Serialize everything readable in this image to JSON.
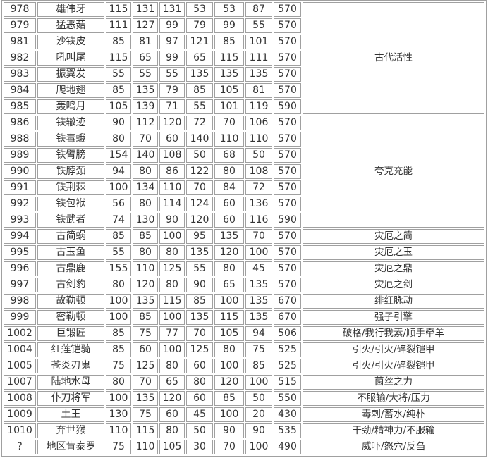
{
  "rows": [
    {
      "no": "978",
      "name": "雄伟牙",
      "stats": [
        "115",
        "131",
        "131",
        "53",
        "53",
        "87"
      ],
      "total": "570",
      "ability": "古代活性",
      "span": 7
    },
    {
      "no": "979",
      "name": "猛恶菇",
      "stats": [
        "111",
        "127",
        "99",
        "79",
        "99",
        "55"
      ],
      "total": "570"
    },
    {
      "no": "981",
      "name": "沙铁皮",
      "stats": [
        "85",
        "81",
        "97",
        "121",
        "85",
        "101"
      ],
      "total": "570"
    },
    {
      "no": "982",
      "name": "吼叫尾",
      "stats": [
        "115",
        "65",
        "99",
        "65",
        "115",
        "111"
      ],
      "total": "570"
    },
    {
      "no": "983",
      "name": "振翼发",
      "stats": [
        "55",
        "55",
        "55",
        "135",
        "135",
        "135"
      ],
      "total": "570"
    },
    {
      "no": "984",
      "name": "爬地翅",
      "stats": [
        "85",
        "135",
        "79",
        "85",
        "105",
        "81"
      ],
      "total": "570"
    },
    {
      "no": "985",
      "name": "轰鸣月",
      "stats": [
        "105",
        "139",
        "71",
        "55",
        "101",
        "119"
      ],
      "total": "590"
    },
    {
      "no": "986",
      "name": "铁辙迹",
      "stats": [
        "90",
        "112",
        "120",
        "72",
        "70",
        "106"
      ],
      "total": "570",
      "ability": "夸克充能",
      "span": 7
    },
    {
      "no": "988",
      "name": "铁毒蛾",
      "stats": [
        "80",
        "70",
        "60",
        "140",
        "110",
        "110"
      ],
      "total": "570"
    },
    {
      "no": "989",
      "name": "铁臂膀",
      "stats": [
        "154",
        "140",
        "108",
        "50",
        "68",
        "50"
      ],
      "total": "570"
    },
    {
      "no": "990",
      "name": "铁脖颈",
      "stats": [
        "94",
        "80",
        "86",
        "122",
        "80",
        "108"
      ],
      "total": "570"
    },
    {
      "no": "991",
      "name": "铁荆棘",
      "stats": [
        "100",
        "134",
        "110",
        "70",
        "84",
        "72"
      ],
      "total": "570"
    },
    {
      "no": "992",
      "name": "铁包袱",
      "stats": [
        "56",
        "80",
        "114",
        "124",
        "60",
        "136"
      ],
      "total": "570"
    },
    {
      "no": "993",
      "name": "铁武者",
      "stats": [
        "74",
        "130",
        "90",
        "120",
        "60",
        "116"
      ],
      "total": "590"
    },
    {
      "no": "994",
      "name": "古简蜗",
      "stats": [
        "85",
        "85",
        "100",
        "95",
        "135",
        "70"
      ],
      "total": "570",
      "ability": "灾厄之简",
      "span": 1
    },
    {
      "no": "995",
      "name": "古玉鱼",
      "stats": [
        "55",
        "80",
        "80",
        "135",
        "120",
        "100"
      ],
      "total": "570",
      "ability": "灾厄之玉",
      "span": 1
    },
    {
      "no": "996",
      "name": "古鼎鹿",
      "stats": [
        "155",
        "110",
        "125",
        "55",
        "80",
        "45"
      ],
      "total": "570",
      "ability": "灾厄之鼎",
      "span": 1
    },
    {
      "no": "997",
      "name": "古剑豹",
      "stats": [
        "80",
        "120",
        "80",
        "90",
        "65",
        "135"
      ],
      "total": "570",
      "ability": "灾厄之剑",
      "span": 1
    },
    {
      "no": "998",
      "name": "故勒顿",
      "stats": [
        "100",
        "135",
        "115",
        "85",
        "100",
        "135"
      ],
      "total": "670",
      "ability": "绯红脉动",
      "span": 1
    },
    {
      "no": "999",
      "name": "密勒顿",
      "stats": [
        "100",
        "85",
        "100",
        "135",
        "115",
        "135"
      ],
      "total": "670",
      "ability": "强子引擎",
      "span": 1
    },
    {
      "no": "1002",
      "name": "巨锻匠",
      "stats": [
        "85",
        "75",
        "77",
        "70",
        "105",
        "94"
      ],
      "total": "506",
      "ability": "破格/我行我素/顺手牵羊",
      "span": 1
    },
    {
      "no": "1004",
      "name": "红莲铠骑",
      "stats": [
        "85",
        "60",
        "100",
        "125",
        "80",
        "75"
      ],
      "total": "525",
      "ability": "引火/引火/碎裂铠甲",
      "span": 1
    },
    {
      "no": "1005",
      "name": "苍炎刃鬼",
      "stats": [
        "75",
        "125",
        "80",
        "60",
        "100",
        "85"
      ],
      "total": "525",
      "ability": "引火/引火/碎裂铠甲",
      "span": 1
    },
    {
      "no": "1007",
      "name": "陆地水母",
      "stats": [
        "80",
        "70",
        "65",
        "80",
        "120",
        "100"
      ],
      "total": "515",
      "ability": "菌丝之力",
      "span": 1
    },
    {
      "no": "1008",
      "name": "仆刀将军",
      "stats": [
        "100",
        "135",
        "120",
        "60",
        "85",
        "50"
      ],
      "total": "550",
      "ability": "不服输/大将/压力",
      "span": 1
    },
    {
      "no": "1009",
      "name": "土王",
      "stats": [
        "130",
        "75",
        "60",
        "45",
        "100",
        "20"
      ],
      "total": "430",
      "ability": "毒刺/蓄水/纯朴",
      "span": 1
    },
    {
      "no": "1010",
      "name": "弃世猴",
      "stats": [
        "110",
        "115",
        "80",
        "50",
        "90",
        "90"
      ],
      "total": "535",
      "ability": "干劲/精神力/不服输",
      "span": 1
    },
    {
      "no": "?",
      "name": "地区肯泰罗",
      "stats": [
        "75",
        "110",
        "105",
        "30",
        "70",
        "100"
      ],
      "total": "490",
      "ability": "威吓/怒穴/反刍",
      "span": 1
    }
  ]
}
